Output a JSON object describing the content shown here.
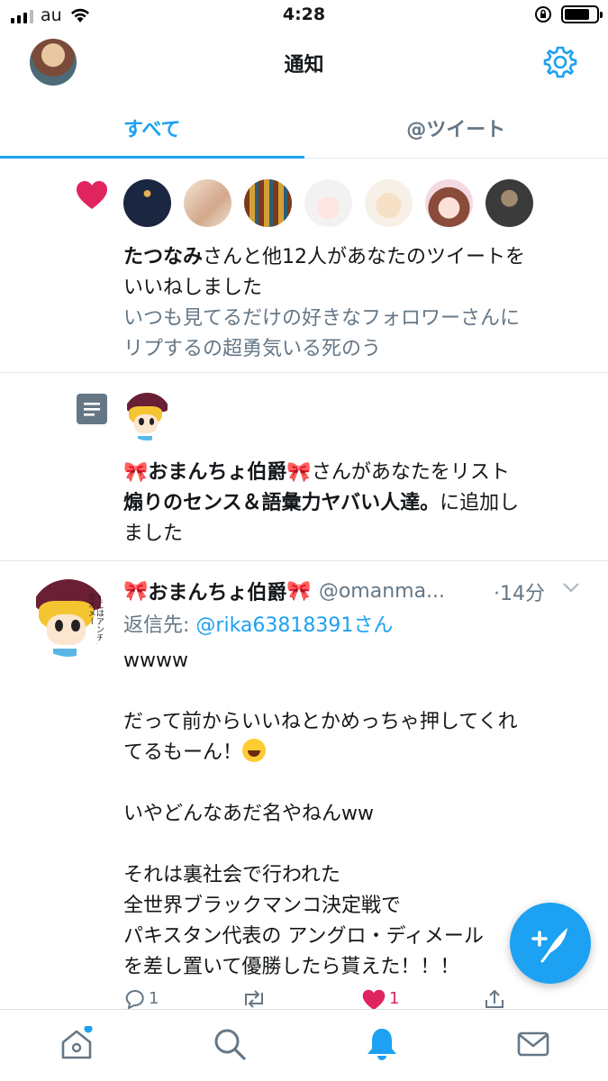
{
  "status_bar": {
    "carrier": "au",
    "time": "4:28"
  },
  "header": {
    "title": "通知",
    "settings_icon": "gear-icon",
    "accent_color": "#1da1f2"
  },
  "tabs": [
    {
      "label": "すべて",
      "active": true
    },
    {
      "label": "@ツイート",
      "active": false
    }
  ],
  "notifications": {
    "like": {
      "icon": "heart-icon",
      "actor": "たつなみ",
      "text_after_actor": "さんと他12人があなたのツイートを",
      "text_line2": "いいねしました",
      "quoted_line1": "いつも見てるだけの好きなフォロワーさんに",
      "quoted_line2": "リプするの超勇気いる死のう"
    },
    "list": {
      "icon": "list-icon",
      "ribbon": "🎀",
      "actor": "おまんちょ伯爵",
      "text_after_actor": "さんがあなたをリスト",
      "list_name": "煽りのセンス＆語彙力ヤバい人達。",
      "text_after_list": "に追加し",
      "text_line3": "ました"
    }
  },
  "tweet": {
    "ribbon": "🎀",
    "display_name": "おまんちょ伯爵",
    "handle": "@omanma...",
    "time": "·14分",
    "reply_prefix": "返信先: ",
    "reply_to": "@rika63818391さん",
    "avatar_caption": "そこはアンチだなオメー",
    "body": {
      "p1": "wwww",
      "p2_line1": "だって前からいいねとかめっちゃ押してくれ",
      "p2_line2": "てるもーん！",
      "p3": "いやどんなあだ名やねんww",
      "p4_line1": "それは裏社会で行われた",
      "p4_line2": "全世界ブラックマンコ決定戦で",
      "p4_line3": "パキスタン代表の アングロ・ディメール",
      "p4_line4": "を差し置いて優勝したら貰えた！！！"
    },
    "reply_count": "1",
    "like_count": "1"
  },
  "bottom_nav": [
    "home-icon",
    "search-icon",
    "bell-icon",
    "mail-icon"
  ]
}
